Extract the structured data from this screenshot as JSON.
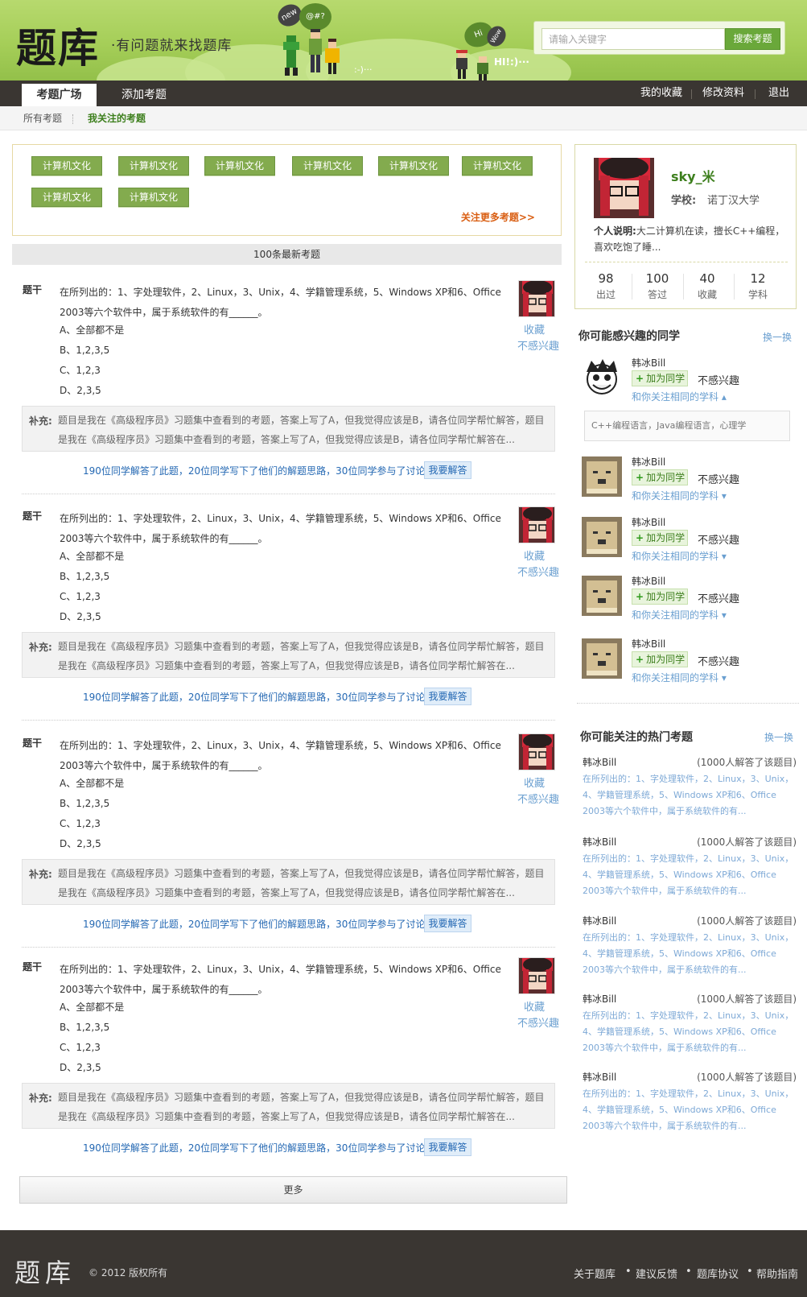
{
  "header": {
    "logo": "题库",
    "slogan": "·有问题就来找题库",
    "bubble_new": "new",
    "bubble_hi": "Hi",
    "bubble_wow": "Wow",
    "pixel_text_1": ":-)···",
    "pixel_text_2": "HI!:)···",
    "search_placeholder": "请输入关键字",
    "search_button": "搜索考题"
  },
  "nav": {
    "tabs": [
      "考题广场",
      "添加考题"
    ],
    "right": [
      "我的收藏",
      "修改资料",
      "退出"
    ]
  },
  "subnav": {
    "items": [
      "所有考题",
      "我关注的考题"
    ]
  },
  "tags": {
    "items": [
      "计算机文化",
      "计算机文化",
      "计算机文化",
      "计算机文化",
      "计算机文化",
      "计算机文化",
      "计算机文化",
      "计算机文化"
    ],
    "more": "关注更多考题>>"
  },
  "section_title": "100条最新考题",
  "question_template": {
    "label": "题干",
    "text": "在所列出的：1、字处理软件，2、Linux，3、Unix，4、学籍管理系统，5、Windows XP和6、Office 2003等六个软件中，属于系统软件的有______。",
    "options": [
      "A、全部都不是",
      "B、1,2,3,5",
      "C、1,2,3",
      "D、2,3,5"
    ],
    "collect": "收藏",
    "ignore": "不感兴趣",
    "supp_label": "补充:",
    "supp_text": "题目是我在《高级程序员》习题集中查看到的考题，答案上写了A，但我觉得应该是B，请各位同学帮忙解答，题目是我在《高级程序员》习题集中查看到的考题，答案上写了A，但我觉得应该是B，请各位同学帮忙解答在...",
    "stats": "190位同学解答了此题，20位同学写下了他们的解题思路，30位同学参与了讨论",
    "answer_button": "我要解答"
  },
  "questions": [
    {
      "label": "题干",
      "text": "在所列出的：1、字处理软件，2、Linux，3、Unix，4、学籍管理系统，5、Windows XP和6、Office 2003等六个软件中，属于系统软件的有______。",
      "opt_a": "A、全部都不是",
      "opt_b": "B、1,2,3,5",
      "opt_c": "C、1,2,3",
      "opt_d": "D、2,3,5",
      "collect": "收藏",
      "ignore": "不感兴趣",
      "supp_label": "补充:",
      "supp_text": "题目是我在《高级程序员》习题集中查看到的考题，答案上写了A，但我觉得应该是B，请各位同学帮忙解答，题目是我在《高级程序员》习题集中查看到的考题，答案上写了A，但我觉得应该是B，请各位同学帮忙解答在...",
      "stats": "190位同学解答了此题，20位同学写下了他们的解题思路，30位同学参与了讨论",
      "answer_button": "我要解答"
    },
    {
      "label": "题干",
      "text": "在所列出的：1、字处理软件，2、Linux，3、Unix，4、学籍管理系统，5、Windows XP和6、Office 2003等六个软件中，属于系统软件的有______。",
      "opt_a": "A、全部都不是",
      "opt_b": "B、1,2,3,5",
      "opt_c": "C、1,2,3",
      "opt_d": "D、2,3,5",
      "collect": "收藏",
      "ignore": "不感兴趣",
      "supp_label": "补充:",
      "supp_text": "题目是我在《高级程序员》习题集中查看到的考题，答案上写了A，但我觉得应该是B，请各位同学帮忙解答，题目是我在《高级程序员》习题集中查看到的考题，答案上写了A，但我觉得应该是B，请各位同学帮忙解答在...",
      "stats": "190位同学解答了此题，20位同学写下了他们的解题思路，30位同学参与了讨论",
      "answer_button": "我要解答"
    },
    {
      "label": "题干",
      "text": "在所列出的：1、字处理软件，2、Linux，3、Unix，4、学籍管理系统，5、Windows XP和6、Office 2003等六个软件中，属于系统软件的有______。",
      "opt_a": "A、全部都不是",
      "opt_b": "B、1,2,3,5",
      "opt_c": "C、1,2,3",
      "opt_d": "D、2,3,5",
      "collect": "收藏",
      "ignore": "不感兴趣",
      "supp_label": "补充:",
      "supp_text": "题目是我在《高级程序员》习题集中查看到的考题，答案上写了A，但我觉得应该是B，请各位同学帮忙解答，题目是我在《高级程序员》习题集中查看到的考题，答案上写了A，但我觉得应该是B，请各位同学帮忙解答在...",
      "stats": "190位同学解答了此题，20位同学写下了他们的解题思路，30位同学参与了讨论",
      "answer_button": "我要解答"
    },
    {
      "label": "题干",
      "text": "在所列出的：1、字处理软件，2、Linux，3、Unix，4、学籍管理系统，5、Windows XP和6、Office 2003等六个软件中，属于系统软件的有______。",
      "opt_a": "A、全部都不是",
      "opt_b": "B、1,2,3,5",
      "opt_c": "C、1,2,3",
      "opt_d": "D、2,3,5",
      "collect": "收藏",
      "ignore": "不感兴趣",
      "supp_label": "补充:",
      "supp_text": "题目是我在《高级程序员》习题集中查看到的考题，答案上写了A，但我觉得应该是B，请各位同学帮忙解答，题目是我在《高级程序员》习题集中查看到的考题，答案上写了A，但我觉得应该是B，请各位同学帮忙解答在...",
      "stats": "190位同学解答了此题，20位同学写下了他们的解题思路，30位同学参与了讨论",
      "answer_button": "我要解答"
    }
  ],
  "more_button": "更多",
  "profile": {
    "name": "sky_米",
    "school_label": "学校:",
    "school": "诺丁汉大学",
    "bio_label": "个人说明:",
    "bio": "大二计算机在读，擅长C++编程，喜欢吃饱了睡...",
    "stats": [
      {
        "num": "98",
        "label": "出过"
      },
      {
        "num": "100",
        "label": "答过"
      },
      {
        "num": "40",
        "label": "收藏"
      },
      {
        "num": "12",
        "label": "学科"
      }
    ]
  },
  "friends_section": {
    "title": "你可能感兴趣的同学",
    "refresh": "换一换",
    "tags_text": "C++编程语言，Java编程语言，心理学",
    "items": [
      {
        "name": "韩冰Bill",
        "add": "加为同学",
        "ignore": "不感兴趣",
        "follow": "和你关注相同的学科 ▴"
      },
      {
        "name": "韩冰Bill",
        "add": "加为同学",
        "ignore": "不感兴趣",
        "follow": "和你关注相同的学科 ▾"
      },
      {
        "name": "韩冰Bill",
        "add": "加为同学",
        "ignore": "不感兴趣",
        "follow": "和你关注相同的学科 ▾"
      },
      {
        "name": "韩冰Bill",
        "add": "加为同学",
        "ignore": "不感兴趣",
        "follow": "和你关注相同的学科 ▾"
      },
      {
        "name": "韩冰Bill",
        "add": "加为同学",
        "ignore": "不感兴趣",
        "follow": "和你关注相同的学科 ▾"
      }
    ]
  },
  "hot_section": {
    "title": "你可能关注的热门考题",
    "refresh": "换一换",
    "items": [
      {
        "name": "韩冰Bill",
        "count": "(1000人解答了该题目)",
        "text": "在所列出的：1、字处理软件，2、Linux，3、Unix，4、学籍管理系统，5、Windows XP和6、Office 2003等六个软件中，属于系统软件的有..."
      },
      {
        "name": "韩冰Bill",
        "count": "(1000人解答了该题目)",
        "text": "在所列出的：1、字处理软件，2、Linux，3、Unix，4、学籍管理系统，5、Windows XP和6、Office 2003等六个软件中，属于系统软件的有..."
      },
      {
        "name": "韩冰Bill",
        "count": "(1000人解答了该题目)",
        "text": "在所列出的：1、字处理软件，2、Linux，3、Unix，4、学籍管理系统，5、Windows XP和6、Office 2003等六个软件中，属于系统软件的有..."
      },
      {
        "name": "韩冰Bill",
        "count": "(1000人解答了该题目)",
        "text": "在所列出的：1、字处理软件，2、Linux，3、Unix，4、学籍管理系统，5、Windows XP和6、Office 2003等六个软件中，属于系统软件的有..."
      },
      {
        "name": "韩冰Bill",
        "count": "(1000人解答了该题目)",
        "text": "在所列出的：1、字处理软件，2、Linux，3、Unix，4、学籍管理系统，5、Windows XP和6、Office 2003等六个软件中，属于系统软件的有..."
      }
    ]
  },
  "footer": {
    "logo": "题库",
    "copyright": "© 2012  版权所有",
    "links": [
      "关于题库",
      "建议反馈",
      "题库协议",
      "帮助指南"
    ],
    "separator": "•"
  },
  "colors": {
    "brand_green": "#83ab4e",
    "link_blue": "#2468b3",
    "dark_bar": "#3a3632",
    "accent_orange": "#d95e12"
  }
}
